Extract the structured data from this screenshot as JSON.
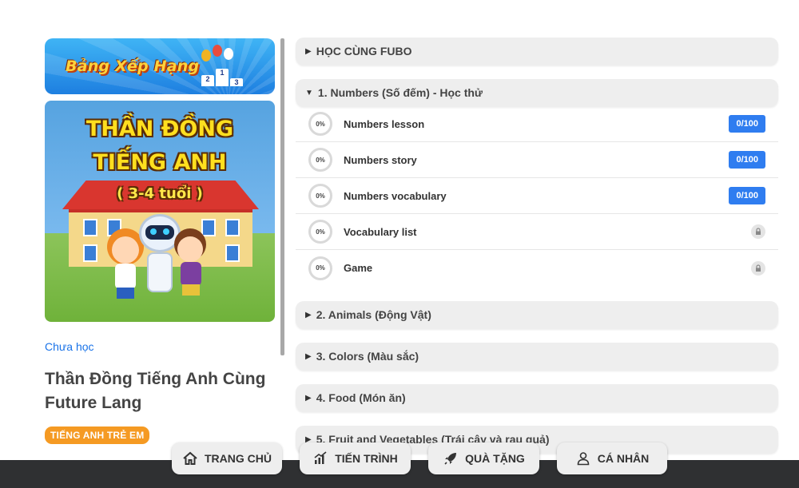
{
  "leftPanel": {
    "rankBanner": "Bảng Xếp Hạng",
    "podium": [
      "2",
      "1",
      "3"
    ],
    "courseImage": {
      "line1": "THẦN ĐỒNG",
      "line2": "TIẾNG ANH",
      "line3": "( 3-4 tuổi )"
    },
    "status": "Chưa học",
    "courseTitle": "Thần Đồng Tiếng Anh Cùng Future Lang",
    "tag": "TIẾNG ANH TRẺ EM"
  },
  "sections": [
    {
      "label": "HỌC CÙNG FUBO",
      "expanded": false
    },
    {
      "label": "1. Numbers (Số đếm) - Học thử",
      "expanded": true
    },
    {
      "label": "2. Animals (Động Vật)",
      "expanded": false
    },
    {
      "label": "3. Colors (Màu sắc)",
      "expanded": false
    },
    {
      "label": "4. Food (Món ăn)",
      "expanded": false
    },
    {
      "label": "5. Fruit and Vegetables (Trái cây và rau quả)",
      "expanded": false
    }
  ],
  "lessons": [
    {
      "progress": "0%",
      "name": "Numbers lesson",
      "score": "0/100",
      "locked": false
    },
    {
      "progress": "0%",
      "name": "Numbers story",
      "score": "0/100",
      "locked": false
    },
    {
      "progress": "0%",
      "name": "Numbers vocabulary",
      "score": "0/100",
      "locked": false
    },
    {
      "progress": "0%",
      "name": "Vocabulary list",
      "score": "",
      "locked": true
    },
    {
      "progress": "0%",
      "name": "Game",
      "score": "",
      "locked": true
    }
  ],
  "bottomNav": {
    "home": "TRANG CHỦ",
    "progress": "TIẾN TRÌNH",
    "gifts": "QUÀ TẶNG",
    "profile": "CÁ NHÂN"
  },
  "colors": {
    "accent": "#2f7df0",
    "tag": "#f59a23",
    "link": "#1a73e8",
    "bottomBar": "#2f3032"
  }
}
